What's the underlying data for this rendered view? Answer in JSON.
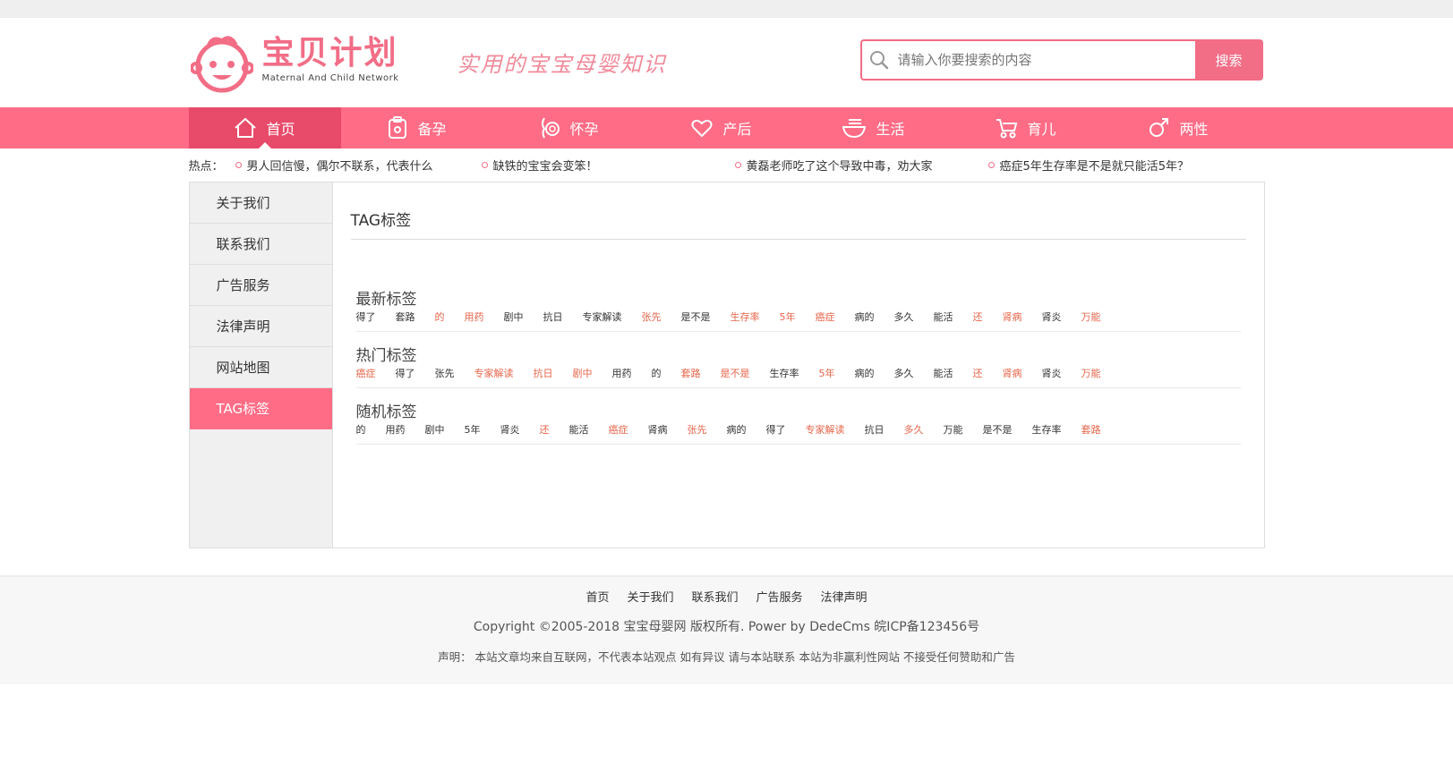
{
  "header": {
    "logo_title": "宝贝计划",
    "logo_subtitle": "Maternal And Child Network",
    "slogan": "实用的宝宝母婴知识",
    "search_placeholder": "请输入你要搜索的内容",
    "search_button": "搜索"
  },
  "colors": {
    "accent": "#ff6c86",
    "accent_dark": "#e84a6a",
    "tag_highlight": "#e7654a"
  },
  "nav": {
    "items": [
      {
        "label": "首页",
        "icon": "home-icon"
      },
      {
        "label": "备孕",
        "icon": "clipboard-icon"
      },
      {
        "label": "怀孕",
        "icon": "pregnancy-icon"
      },
      {
        "label": "产后",
        "icon": "heart-hand-icon"
      },
      {
        "label": "生活",
        "icon": "bowl-icon"
      },
      {
        "label": "育儿",
        "icon": "stroller-icon"
      },
      {
        "label": "两性",
        "icon": "gender-icon"
      }
    ]
  },
  "hot": {
    "label": "热点：",
    "items": [
      "男人回信慢，偶尔不联系，代表什么",
      "缺铁的宝宝会变笨！",
      "黄磊老师吃了这个导致中毒，劝大家",
      "癌症5年生存率是不是就只能活5年？"
    ]
  },
  "sidebar": {
    "items": [
      "关于我们",
      "联系我们",
      "广告服务",
      "法律声明",
      "网站地图",
      "TAG标签"
    ]
  },
  "main": {
    "title": "TAG标签",
    "sections": [
      {
        "heading": "最新标签",
        "tags": [
          "得了",
          "套路",
          "的",
          "用药",
          "剧中",
          "抗日",
          "专家解读",
          "张先",
          "是不是",
          "生存率",
          "5年",
          "癌症",
          "病的",
          "多久",
          "能活",
          "还",
          "肾病",
          "肾炎",
          "万能"
        ]
      },
      {
        "heading": "热门标签",
        "tags": [
          "癌症",
          "得了",
          "张先",
          "专家解读",
          "抗日",
          "剧中",
          "用药",
          "的",
          "套路",
          "是不是",
          "生存率",
          "5年",
          "病的",
          "多久",
          "能活",
          "还",
          "肾病",
          "肾炎",
          "万能"
        ]
      },
      {
        "heading": "随机标签",
        "tags": [
          "的",
          "用药",
          "剧中",
          "5年",
          "肾炎",
          "还",
          "能活",
          "癌症",
          "肾病",
          "张先",
          "病的",
          "得了",
          "专家解读",
          "抗日",
          "多久",
          "万能",
          "是不是",
          "生存率",
          "套路"
        ]
      }
    ]
  },
  "footer": {
    "links": [
      "首页",
      "关于我们",
      "联系我们",
      "广告服务",
      "法律声明"
    ],
    "copyright": "Copyright ©2005-2018 宝宝母婴网 版权所有. Power by DedeCms 皖ICP备123456号",
    "statement": "声明： 本站文章均来自互联网，不代表本站观点 如有异议 请与本站联系 本站为非赢利性网站 不接受任何赞助和广告"
  }
}
